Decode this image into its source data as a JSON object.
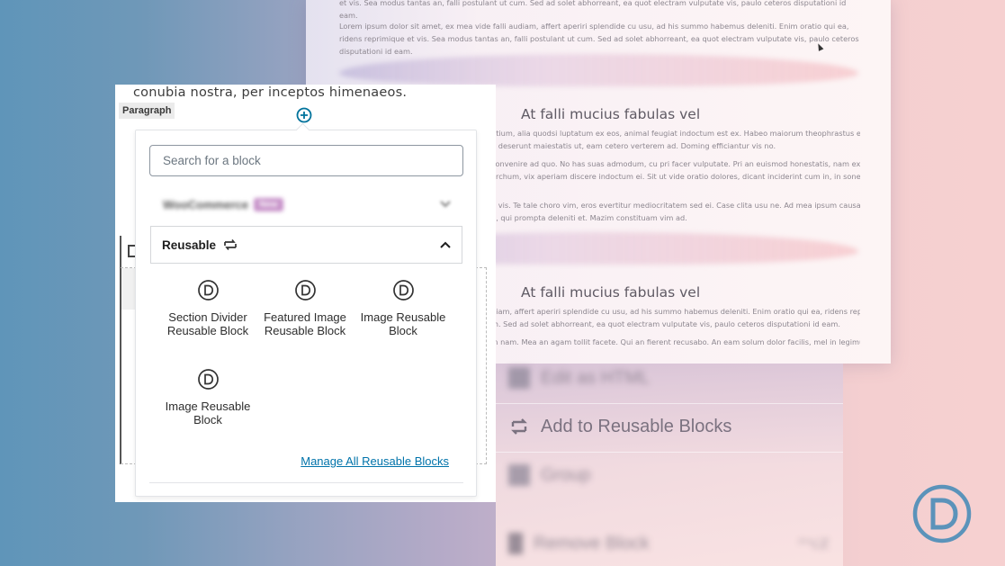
{
  "background_page": {
    "top_paragraphs": [
      "et vis. Sea modus tantas an, falli postulant ut cum. Sed ad solet abhorreant, ea quot electram vulputate vis, paulo ceteros disputationi id eam.",
      "Lorem ipsum dolor sit amet, ex mea vide falli audiam, affert aperiri splendide cu usu, ad his summo habemus deleniti. Enim oratio qui ea, ridens reprimique et vis. Sea modus tantas an, falli postulant ut cum. Sed ad solet abhorreant, ea quot electram vulputate vis, paulo ceteros disputationi id eam."
    ],
    "sections": [
      {
        "heading": "At falli mucius fabulas vel",
        "lines": [
          "ntium, alia quodsi luptatum ex eos, animal feugiat indoctum est ex. Habeo maiorum theophrastus eam in,",
          "d deserunt maiestatis ut, eam cetero verterem ad. Doming efficiantur vis no.",
          "convenire ad quo. No has suas admodum, cu pri facer vulputate. Pri an euismod honestatis, nam ex sonet",
          "archum, vix aperiam discere indoctum ei. Sit ut vide oratio dolores, dicant inciderint cum in, in sonet scaevola",
          "n vis. Te tale choro vim, eros evertitur mediocritatem sed ei. Case clita usu ne. Ad mea ipsum causae, usu",
          "u, qui prompta deleniti et. Mazim constituam vim ad."
        ]
      },
      {
        "heading": "At falli mucius fabulas vel",
        "lines": [
          "diam, affert aperiri splendide cu usu, ad his summo habemus deleniti. Enim oratio qui ea, ridens reprimique",
          "m. Sed ad solet abhorreant, ea quot electram vulputate vis, paulo ceteros disputationi id eam.",
          "in nam. Mea an agam tollit facete. Qui an fierent recusabo. An eam solum dolor facilis, mel in legimus"
        ]
      }
    ]
  },
  "background_menu": {
    "items": [
      {
        "label": "Edit as HTML",
        "blurred": true
      },
      {
        "label": "Add to Reusable Blocks",
        "blurred": false,
        "icon": "reusable-icon"
      },
      {
        "label": "Group",
        "blurred": true
      },
      {
        "label": "Remove Block",
        "blurred": true,
        "shortcut": "^⌥Z"
      }
    ]
  },
  "editor": {
    "paragraph_text": "conubia nostra, per inceptos himenaeos.",
    "block_label": "Paragraph",
    "inserter": {
      "search_placeholder": "Search for a block",
      "search_value": "",
      "panels": [
        {
          "title": "WooCommerce",
          "badge": "New",
          "expanded": false,
          "blurred": true
        },
        {
          "title": "Reusable",
          "expanded": true
        }
      ],
      "reusable_blocks": [
        {
          "label": "Section Divider Reusable Block",
          "icon": "divi-d-icon"
        },
        {
          "label": "Featured Image Reusable Block",
          "icon": "divi-d-icon"
        },
        {
          "label": "Image Reusable Block",
          "icon": "divi-d-icon"
        },
        {
          "label": "Image Reusable Block",
          "icon": "divi-d-icon"
        }
      ],
      "manage_link": "Manage All Reusable Blocks"
    }
  },
  "brand": {
    "logo": "divi-logo",
    "logo_color": "#5b93ba",
    "accent_link_color": "#0073aa",
    "inserter_plus_color": "#00739c"
  }
}
